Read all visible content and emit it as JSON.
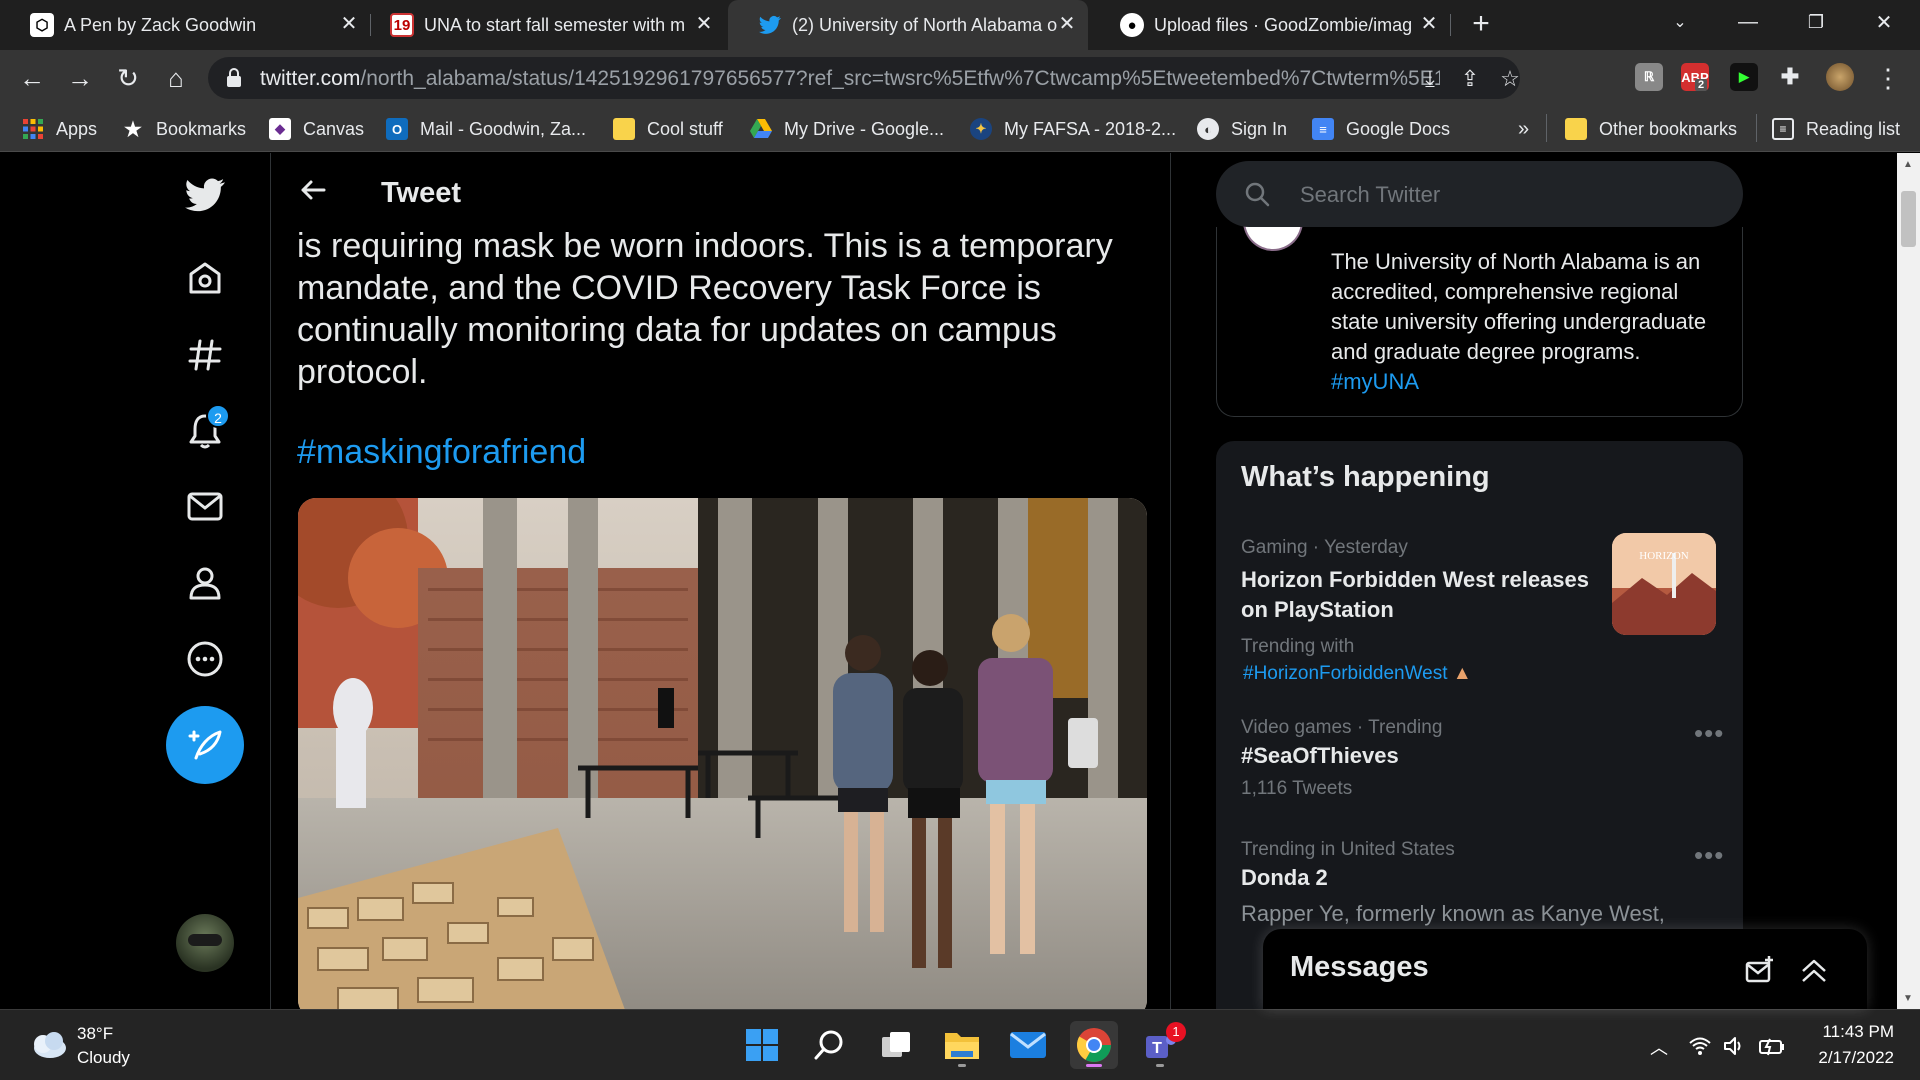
{
  "browser": {
    "tabs": [
      {
        "title": "A Pen by Zack Goodwin",
        "active": false
      },
      {
        "title": "UNA to start fall semester with m",
        "active": false
      },
      {
        "title": "(2) University of North Alabama o",
        "active": true
      },
      {
        "title": "Upload files · GoodZombie/imag",
        "active": false
      }
    ],
    "url_host": "twitter.com",
    "url_path": "/north_alabama/status/1425192961797656577?ref_src=twsrc%5Etfw%7Ctwcamp%5Etweetembed%7Ctwterm%5E142...",
    "extension_badge": "2",
    "bookmarks": [
      {
        "label": "Apps",
        "icon": "apps-grid-icon"
      },
      {
        "label": "Bookmarks",
        "icon": "star-icon"
      },
      {
        "label": "Canvas",
        "icon": "canvas-icon"
      },
      {
        "label": "Mail - Goodwin, Za...",
        "icon": "outlook-icon"
      },
      {
        "label": "Cool stuff",
        "icon": "folder-icon"
      },
      {
        "label": "My Drive - Google...",
        "icon": "google-drive-icon"
      },
      {
        "label": "My FAFSA - 2018-2...",
        "icon": "fafsa-icon"
      },
      {
        "label": "Sign In",
        "icon": "globe-icon"
      },
      {
        "label": "Google Docs",
        "icon": "google-docs-icon"
      }
    ],
    "overflow_label": "»",
    "other_bookmarks": "Other bookmarks",
    "reading_list": "Reading list"
  },
  "twitter": {
    "header_title": "Tweet",
    "notification_count": "2",
    "tweet_text": "is requiring mask be worn indoors. This is a temporary mandate, and the COVID Recovery Task Force is continually monitoring data for updates on campus protocol.",
    "hashtag": "#maskingforafriend",
    "search_placeholder": "Search Twitter",
    "bio_text": "The University of North Alabama is an accredited, comprehensive regional state university offering undergraduate and graduate degree programs.",
    "bio_hashtag": "#myUNA",
    "trends_title": "What’s happening",
    "trends": [
      {
        "meta": "Gaming · Yesterday",
        "name": "Horizon Forbidden West releases on PlayStation",
        "sub_label": "Trending with",
        "sub_link": "#HorizonForbiddenWest"
      },
      {
        "meta": "Video games · Trending",
        "name": "#SeaOfThieves",
        "count": "1,116 Tweets"
      },
      {
        "meta": "Trending in United States",
        "name": "Donda 2",
        "desc": "Rapper Ye, formerly known as Kanye West,"
      }
    ],
    "messages_title": "Messages"
  },
  "taskbar": {
    "temperature": "38°F",
    "condition": "Cloudy",
    "time": "11:43 PM",
    "date": "2/17/2022",
    "teams_badge": "1"
  }
}
